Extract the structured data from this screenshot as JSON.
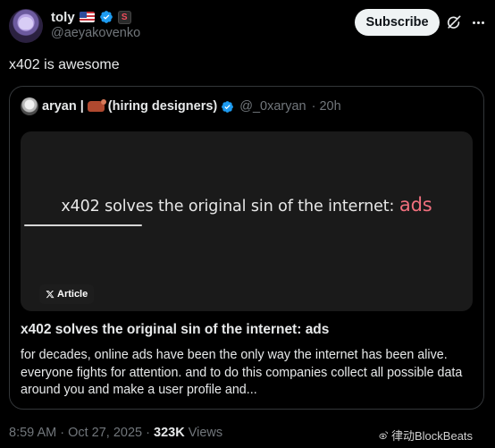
{
  "author": {
    "display_name": "toly",
    "handle": "@aeyakovenko",
    "badge_letter": "S"
  },
  "header": {
    "subscribe_label": "Subscribe"
  },
  "tweet": {
    "text": "x402 is awesome"
  },
  "quoted": {
    "author_name": "aryan |",
    "author_suffix": "(hiring designers)",
    "handle": "@_0xaryan",
    "time": "· 20h",
    "card": {
      "headline_prefix": "x402 solves the original sin of the internet:",
      "headline_accent": "ads",
      "badge_label": "Article"
    },
    "title": "x402 solves the original sin of the internet: ads",
    "body": "for decades, online ads have been the only way the internet has been alive. everyone fights for attention. and to do this companies collect all possible data around you and make a user profile and..."
  },
  "footer": {
    "time": "8:59 AM · Oct 27, 2025 · ",
    "views_count": "323K",
    "views_label": " Views"
  },
  "watermark": {
    "text": "律动BlockBeats"
  },
  "colors": {
    "accent_blue": "#1d9bf0",
    "ads_pink": "#f06f7d",
    "background": "#000000",
    "muted": "#71767b"
  }
}
